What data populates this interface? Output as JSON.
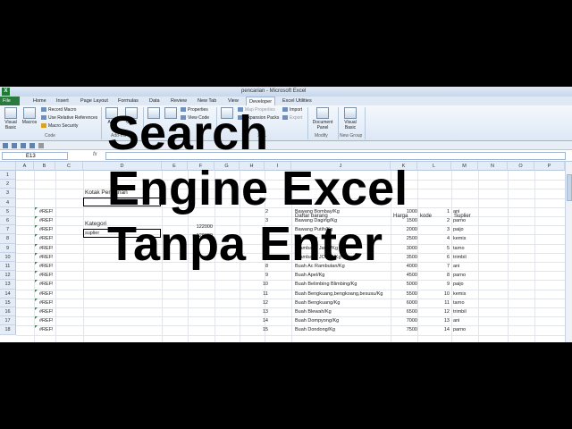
{
  "window": {
    "title": "pencarian - Microsoft Excel",
    "app_icon": "X"
  },
  "ribbon_tabs": [
    "File",
    "Home",
    "Insert",
    "Page Layout",
    "Formulas",
    "Data",
    "Review",
    "New Tab",
    "View",
    "Developer",
    "Excel Utilities"
  ],
  "active_tab": "Developer",
  "ribbon": {
    "code": {
      "visual_basic": "Visual Basic",
      "macros": "Macros",
      "record_macro": "Record Macro",
      "use_relative": "Use Relative References",
      "macro_security": "Macro Security",
      "label": "Code"
    },
    "addins": {
      "addins": "Add",
      "com": "COM",
      "label": "Add-Ins"
    },
    "controls": {
      "properties": "Properties",
      "view_code": "View Code"
    },
    "xml": {
      "map_properties": "Map Properties",
      "expansion_packs": "Expansion Packs",
      "import": "Import",
      "export": "Export",
      "label": "XML"
    },
    "modify": {
      "document_panel": "Document Panel",
      "label": "Modify"
    },
    "new_group": {
      "visual_basic": "Visual Basic",
      "label": "New Group"
    }
  },
  "formula_bar": {
    "name_box": "E13",
    "fx": "fx",
    "formula": ""
  },
  "columns": [
    "A",
    "B",
    "C",
    "D",
    "E",
    "F",
    "G",
    "H",
    "I",
    "J",
    "K",
    "L",
    "M",
    "N",
    "O",
    "P"
  ],
  "rows": [
    "1",
    "2",
    "3",
    "4",
    "5",
    "6",
    "7",
    "8",
    "9",
    "10",
    "11",
    "12",
    "13",
    "14",
    "15",
    "16",
    "17",
    "18"
  ],
  "sheet": {
    "kotak_pencarian": "Kotak Pencarian",
    "kategori": "Kategori",
    "kategori_value": "suplier",
    "ref_error": "#REF!",
    "f_values": [
      "122000",
      "128000"
    ],
    "h_numbers": [
      "2",
      "3",
      "4",
      "5",
      "6",
      "7",
      "8",
      "9",
      "10",
      "11",
      "12",
      "13",
      "14",
      "15"
    ],
    "headers": {
      "barang": "Daftar barang",
      "harga": "Harga",
      "kode": "kode",
      "suplier": "Suplier"
    },
    "items": [
      {
        "barang": "Bawang Bombay/Kg",
        "harga": "1000",
        "kode": "1",
        "suplier": "ani"
      },
      {
        "barang": "Bawang Daging/Kg",
        "harga": "1500",
        "kode": "2",
        "suplier": "parno"
      },
      {
        "barang": "Bawang Putih/Kg",
        "harga": "2000",
        "kode": "3",
        "suplier": "paijo"
      },
      {
        "barang": "Brambang",
        "harga": "2500",
        "kode": "4",
        "suplier": "kemis"
      },
      {
        "barang": "Brambang Jawa/Kg",
        "harga": "3000",
        "kode": "5",
        "suplier": "tarno"
      },
      {
        "barang": "Brambang JOWO/Kg",
        "harga": "3500",
        "kode": "6",
        "suplier": "trimbil"
      },
      {
        "barang": "Buah Ac Rambutan/Kg",
        "harga": "4000",
        "kode": "7",
        "suplier": "ani"
      },
      {
        "barang": "Buah Apel/Kg",
        "harga": "4500",
        "kode": "8",
        "suplier": "parno"
      },
      {
        "barang": "Buah Belimbing Blimbing/Kg",
        "harga": "5000",
        "kode": "9",
        "suplier": "paijo"
      },
      {
        "barang": "Buah Bengkuang,bengkoang,besusu/Kg",
        "harga": "5500",
        "kode": "10",
        "suplier": "kemis"
      },
      {
        "barang": "Buah Bengkuang/Kg",
        "harga": "6000",
        "kode": "11",
        "suplier": "tarno"
      },
      {
        "barang": "Buah Blewah/Kg",
        "harga": "6500",
        "kode": "12",
        "suplier": "trimbil"
      },
      {
        "barang": "Buah Dompyong/Kg",
        "harga": "7000",
        "kode": "13",
        "suplier": "ani"
      },
      {
        "barang": "Buah Dondong/Kg",
        "harga": "7500",
        "kode": "14",
        "suplier": "parno"
      }
    ]
  },
  "overlay_title": [
    "Search",
    "Engine Excel",
    "Tanpa Enter"
  ]
}
